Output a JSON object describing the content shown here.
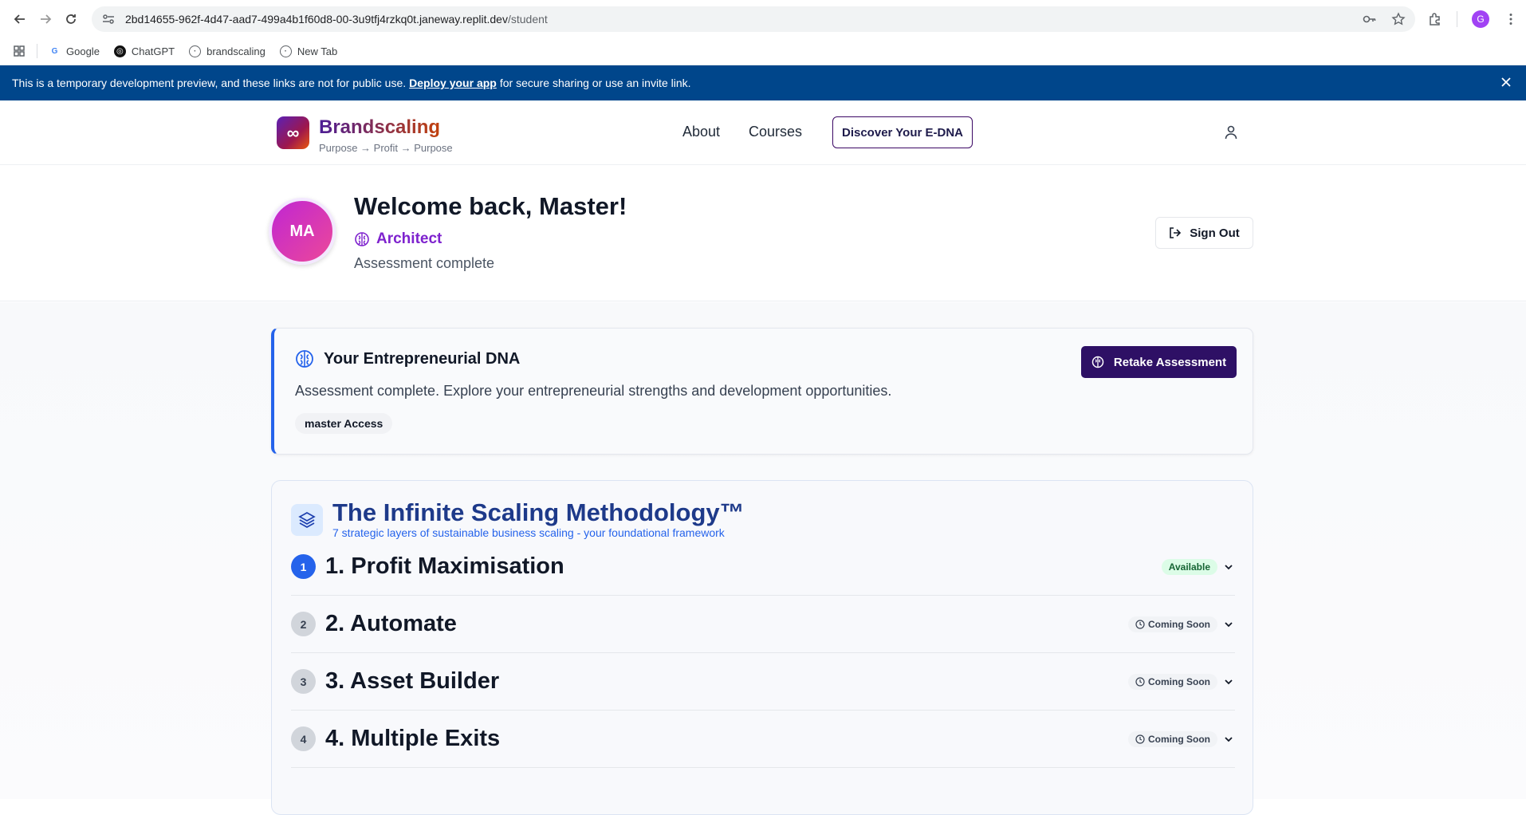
{
  "browser": {
    "url_host": "2bd14655-962f-4d47-aad7-499a4b1f60d8-00-3u9tfj4rzkq0t.janeway.replit.dev",
    "url_path": "/student",
    "profile_initial": "G",
    "bookmarks": [
      {
        "label": "Google",
        "icon": "google-icon"
      },
      {
        "label": "ChatGPT",
        "icon": "chatgpt-icon"
      },
      {
        "label": "brandscaling",
        "icon": "globe-icon"
      },
      {
        "label": "New Tab",
        "icon": "globe-icon"
      }
    ]
  },
  "banner": {
    "text_before": "This is a temporary development preview, and these links are not for public use.",
    "link": "Deploy your app",
    "text_after": "for secure sharing or use an invite link."
  },
  "header": {
    "logo_symbol": "∞",
    "brand": "Brandscaling",
    "tagline": "Purpose → Profit → Purpose",
    "nav": [
      "About",
      "Courses"
    ],
    "cta": "Discover Your E-DNA"
  },
  "welcome": {
    "initials": "MA",
    "title": "Welcome back, Master!",
    "type": "Architect",
    "status": "Assessment complete",
    "signout": "Sign Out"
  },
  "dna_card": {
    "title": "Your Entrepreneurial DNA",
    "description": "Assessment complete. Explore your entrepreneurial strengths and development opportunities.",
    "badge": "master Access",
    "retake": "Retake Assessment"
  },
  "methodology": {
    "title": "The Infinite Scaling Methodology™",
    "subtitle": "7 strategic layers of sustainable business scaling - your foundational framework",
    "layers": [
      {
        "num": "1",
        "title": "1. Profit Maximisation",
        "status": "Available"
      },
      {
        "num": "2",
        "title": "2. Automate",
        "status": "Coming Soon"
      },
      {
        "num": "3",
        "title": "3. Asset Builder",
        "status": "Coming Soon"
      },
      {
        "num": "4",
        "title": "4. Multiple Exits",
        "status": "Coming Soon"
      }
    ]
  },
  "colors": {
    "banner": "#00468b",
    "primary_dark": "#2e1065",
    "accent_blue": "#2563eb",
    "architect_purple": "#7e22ce"
  }
}
